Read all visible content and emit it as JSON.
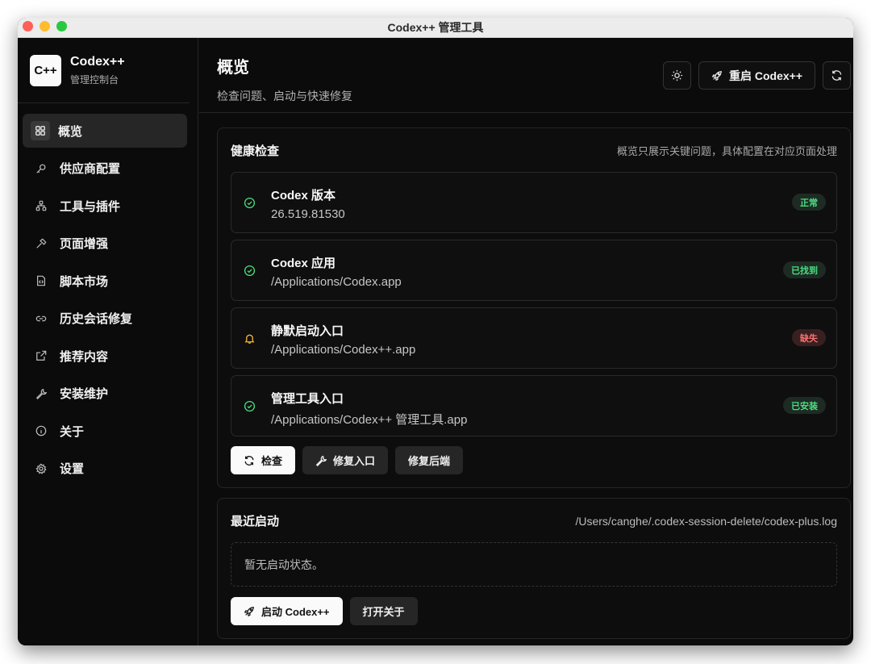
{
  "window": {
    "title": "Codex++ 管理工具"
  },
  "brand": {
    "logo": "C++",
    "name": "Codex++",
    "subtitle": "管理控制台"
  },
  "sidebar": {
    "items": [
      {
        "label": "概览",
        "icon": "grid-icon",
        "active": true
      },
      {
        "label": "供应商配置",
        "icon": "key-icon"
      },
      {
        "label": "工具与插件",
        "icon": "network-icon"
      },
      {
        "label": "页面增强",
        "icon": "hammer-icon"
      },
      {
        "label": "脚本市场",
        "icon": "file-code-icon"
      },
      {
        "label": "历史会话修复",
        "icon": "link-icon"
      },
      {
        "label": "推荐内容",
        "icon": "external-link-icon"
      },
      {
        "label": "安装维护",
        "icon": "wrench-icon"
      },
      {
        "label": "关于",
        "icon": "info-icon"
      },
      {
        "label": "设置",
        "icon": "gear-icon"
      }
    ]
  },
  "header": {
    "title": "概览",
    "subtitle": "检查问题、启动与快速修复",
    "restart_label": "重启 Codex++"
  },
  "health": {
    "title": "健康检查",
    "note": "概览只展示关键问题，具体配置在对应页面处理",
    "checks": [
      {
        "name": "Codex 版本",
        "value": "26.519.81530",
        "status": "正常",
        "state": "ok"
      },
      {
        "name": "Codex 应用",
        "value": "/Applications/Codex.app",
        "status": "已找到",
        "state": "ok"
      },
      {
        "name": "静默启动入口",
        "value": "/Applications/Codex++.app",
        "status": "缺失",
        "state": "miss"
      },
      {
        "name": "管理工具入口",
        "value": "/Applications/Codex++ 管理工具.app",
        "status": "已安装",
        "state": "ok"
      }
    ],
    "buttons": {
      "check": "检查",
      "repair_entry": "修复入口",
      "repair_backend": "修复后端"
    }
  },
  "recent": {
    "title": "最近启动",
    "log_path": "/Users/canghe/.codex-session-delete/codex-plus.log",
    "empty": "暂无启动状态。",
    "buttons": {
      "launch": "启动 Codex++",
      "open_about": "打开关于"
    }
  },
  "colors": {
    "ok": "#4ade80",
    "miss": "#f87171",
    "warn": "#f5b83d",
    "accent": "#fafafa"
  }
}
